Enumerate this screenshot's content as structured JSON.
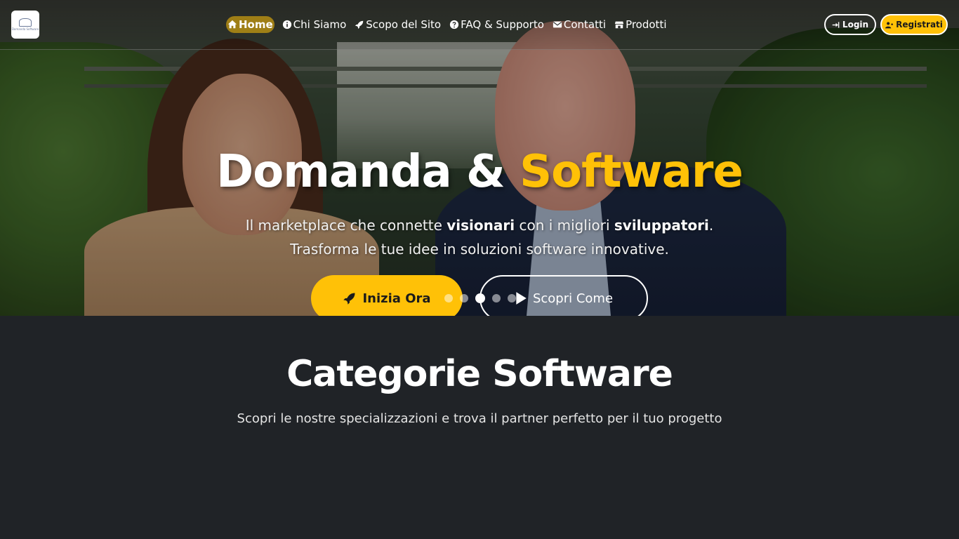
{
  "nav": {
    "logo_text": "Domanda Software",
    "items": [
      {
        "label": "Home",
        "icon": "home-icon",
        "active": true
      },
      {
        "label": "Chi Siamo",
        "icon": "info-icon"
      },
      {
        "label": "Scopo del Sito",
        "icon": "rocket-icon"
      },
      {
        "label": "FAQ & Supporto",
        "icon": "question-icon"
      },
      {
        "label": "Contatti",
        "icon": "envelope-icon"
      },
      {
        "label": "Prodotti",
        "icon": "store-icon"
      }
    ],
    "login_label": "Login",
    "register_label": "Registrati"
  },
  "hero": {
    "title_main": "Domanda & ",
    "title_accent": "Software",
    "subtitle_line1_a": "Il marketplace che connette ",
    "subtitle_line1_b": "visionari",
    "subtitle_line1_c": " con i migliori ",
    "subtitle_line1_d": "sviluppatori",
    "subtitle_line1_e": ".",
    "subtitle_line2": "Trasforma le tue idee in soluzioni software innovative.",
    "cta_primary": "Inizia Ora",
    "cta_secondary": "Scopri Come",
    "carousel_active_index": 2,
    "carousel_count": 5
  },
  "categories": {
    "title": "Categorie Software",
    "subtitle": "Scopri le nostre specializzazioni e trova il partner perfetto per il tuo progetto"
  },
  "colors": {
    "accent": "#ffc107",
    "background": "#202327"
  }
}
